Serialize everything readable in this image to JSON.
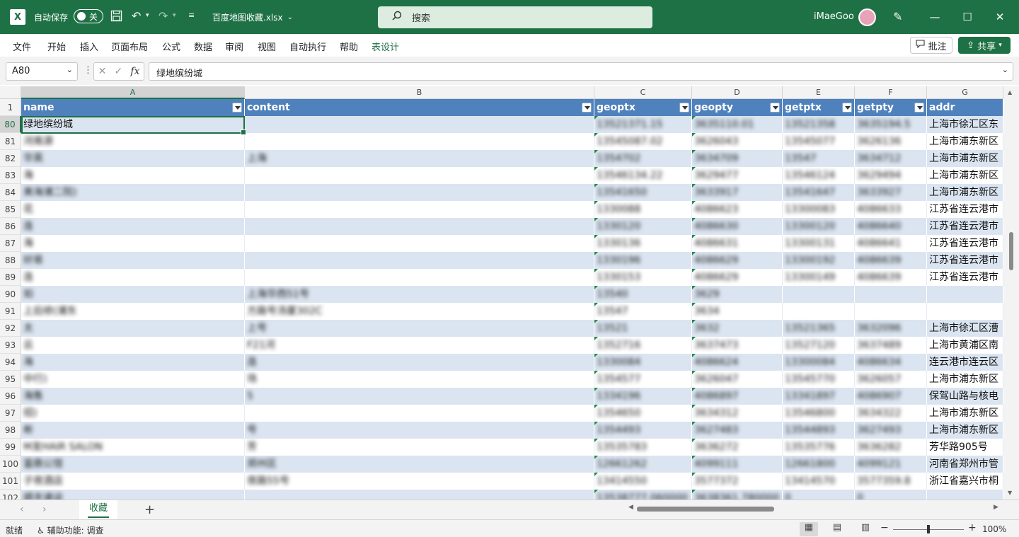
{
  "titlebar": {
    "logo": "X",
    "autosave_label": "自动保存",
    "autosave_state": "关",
    "filename": "百度地图收藏.xlsx",
    "search_placeholder": "搜索",
    "username": "iMaeGoo"
  },
  "menu": {
    "items": [
      "文件",
      "开始",
      "插入",
      "页面布局",
      "公式",
      "数据",
      "审阅",
      "视图",
      "自动执行",
      "帮助",
      "表设计"
    ],
    "comment_label": "批注",
    "share_label": "共享"
  },
  "formula_bar": {
    "cell_ref": "A80",
    "fx_label": "fx",
    "value": "绿地缤纷城"
  },
  "grid": {
    "column_letters": [
      "A",
      "B",
      "C",
      "D",
      "E",
      "F",
      "G"
    ],
    "headers": [
      "name",
      "content",
      "geoptx",
      "geopty",
      "getptx",
      "getpty",
      "addr"
    ],
    "header_row_number": "1",
    "rows": [
      {
        "n": "80",
        "cells": [
          "绿地缤纷城",
          "",
          "13521371.15",
          "3635110.01",
          "13521358",
          "3635194.5",
          "上海市徐汇区东"
        ]
      },
      {
        "n": "81",
        "cells": [
          "河南源",
          "",
          "13545087.02",
          "3626043",
          "13545077",
          "3626136",
          "上海市浦东新区"
        ]
      },
      {
        "n": "82",
        "cells": [
          "华英",
          "上海",
          "1354702",
          "3634709",
          "13547",
          "3634712",
          "上海市浦东新区"
        ]
      },
      {
        "n": "83",
        "cells": [
          "海",
          "",
          "13546134.22",
          "3629477",
          "13546124",
          "3629494",
          "上海市浦东新区"
        ]
      },
      {
        "n": "84",
        "cells": [
          "美海浦二院)",
          "",
          "13541650",
          "3633917",
          "13541647",
          "3633927",
          "上海市浦东新区"
        ]
      },
      {
        "n": "85",
        "cells": [
          "花",
          "",
          "1330088",
          "4086623",
          "13300083",
          "4086633",
          "江苏省连云港市"
        ]
      },
      {
        "n": "86",
        "cells": [
          "连",
          "",
          "1330120",
          "4086630",
          "13300120",
          "4086640",
          "江苏省连云港市"
        ]
      },
      {
        "n": "87",
        "cells": [
          "海",
          "",
          "1330136",
          "4086631",
          "13300131",
          "4086641",
          "江苏省连云港市"
        ]
      },
      {
        "n": "88",
        "cells": [
          "好易",
          "",
          "1330196",
          "4086629",
          "13300192",
          "4086639",
          "江苏省连云港市"
        ]
      },
      {
        "n": "89",
        "cells": [
          "连",
          "",
          "1330153",
          "4086629",
          "13300149",
          "4086639",
          "江苏省连云港市"
        ]
      },
      {
        "n": "90",
        "cells": [
          "如",
          "上海华西51号",
          "13540",
          "3629",
          "",
          "",
          ""
        ]
      },
      {
        "n": "91",
        "cells": [
          "上后修(浦东",
          "方路号汤厦302C",
          "13547",
          "3634",
          "",
          "",
          ""
        ]
      },
      {
        "n": "92",
        "cells": [
          "太",
          "上号",
          "13521",
          "3632",
          "13521365",
          "3632096",
          "上海市徐汇区漕"
        ]
      },
      {
        "n": "93",
        "cells": [
          "云",
          "F21河",
          "1352716",
          "3637473",
          "13527120",
          "3637489",
          "上海市黄浦区南"
        ]
      },
      {
        "n": "94",
        "cells": [
          "海",
          "连",
          "1330084",
          "4086624",
          "13300084",
          "4086634",
          "连云港市连云区"
        ]
      },
      {
        "n": "95",
        "cells": [
          "中行)",
          "场",
          "1354577",
          "3626047",
          "13545770",
          "3626057",
          "上海市浦东新区"
        ]
      },
      {
        "n": "96",
        "cells": [
          "海售",
          "5",
          "1334196",
          "4086897",
          "13341897",
          "4086907",
          "保驾山路与核电"
        ]
      },
      {
        "n": "97",
        "cells": [
          "招)",
          "",
          "1354650",
          "3634312",
          "13546800",
          "3634322",
          "上海市浦东新区"
        ]
      },
      {
        "n": "98",
        "cells": [
          "彬",
          "号",
          "1354493",
          "3627483",
          "13544893",
          "3627493",
          "上海市浦东新区"
        ]
      },
      {
        "n": "99",
        "cells": [
          "M发HAIR SALON",
          "芳",
          "13535783",
          "3636272",
          "13535776",
          "3636282",
          "芳华路905号"
        ]
      },
      {
        "n": "100",
        "cells": [
          "富鼎公馆",
          "郑州区",
          "12661262",
          "4099111",
          "12661800",
          "4099121",
          "河南省郑州市管"
        ]
      },
      {
        "n": "101",
        "cells": [
          "子夜酒店",
          "夜路55号",
          "13414550",
          "3577372",
          "13414570",
          "3577359.8",
          "浙江省嘉兴市桐"
        ]
      },
      {
        "n": "102",
        "cells": [
          "顺丰速运",
          "",
          "13538777.060000",
          "3638361.780000",
          "0",
          "0",
          ""
        ]
      }
    ]
  },
  "sheet_tabs": {
    "active": "收藏",
    "add_label": "+"
  },
  "statusbar": {
    "ready": "就绪",
    "accessibility": "辅助功能: 调查",
    "zoom": "100%",
    "zoom_level": 0.5
  }
}
